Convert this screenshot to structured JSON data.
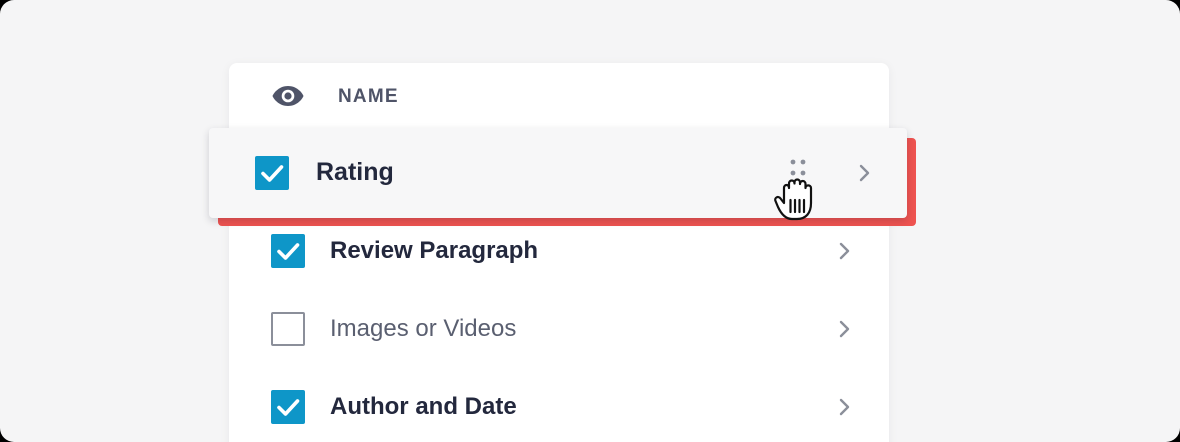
{
  "header": {
    "title": "NAME",
    "icon": "eye-icon"
  },
  "dragging_row": {
    "label": "Rating",
    "checked": true,
    "handle_icon": "drag-handle-icon"
  },
  "rows": [
    {
      "label": "Review Paragraph",
      "checked": true
    },
    {
      "label": "Images or Videos",
      "checked": false
    },
    {
      "label": "Author and Date",
      "checked": true
    }
  ],
  "colors": {
    "checkbox": "#0e96c8",
    "drop_indicator": "#ee5350",
    "text": "#23283d",
    "muted_text": "#5a5f70"
  }
}
